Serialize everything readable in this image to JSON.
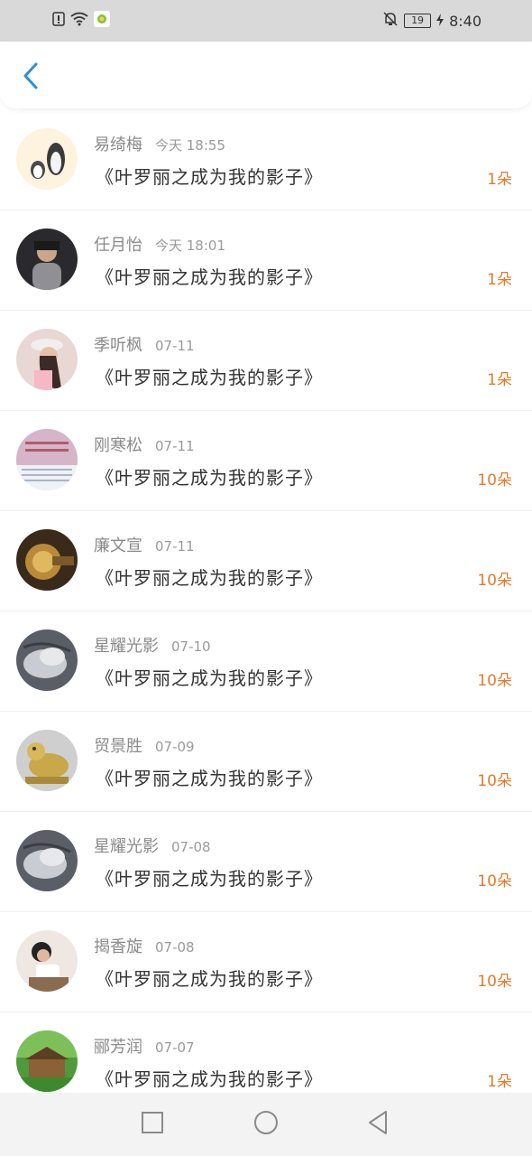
{
  "status_bar": {
    "time": "8:40",
    "battery": "19"
  },
  "header": {
    "back_icon": "chevron-left-icon",
    "accent": "#2b8fd6"
  },
  "colors": {
    "count": "#e47a2a",
    "name": "#8a8a8a"
  },
  "items": [
    {
      "name": "易绮梅",
      "time": "今天 18:55",
      "message": "《叶罗丽之成为我的影子》",
      "count": "1朵"
    },
    {
      "name": "任月怡",
      "time": "今天 18:01",
      "message": "《叶罗丽之成为我的影子》",
      "count": "1朵"
    },
    {
      "name": "季听枫",
      "time": "07-11",
      "message": "《叶罗丽之成为我的影子》",
      "count": "1朵"
    },
    {
      "name": "刚寒松",
      "time": "07-11",
      "message": "《叶罗丽之成为我的影子》",
      "count": "10朵"
    },
    {
      "name": "廉文宣",
      "time": "07-11",
      "message": "《叶罗丽之成为我的影子》",
      "count": "10朵"
    },
    {
      "name": "星耀光影",
      "time": "07-10",
      "message": "《叶罗丽之成为我的影子》",
      "count": "10朵"
    },
    {
      "name": "贸景胜",
      "time": "07-09",
      "message": "《叶罗丽之成为我的影子》",
      "count": "10朵"
    },
    {
      "name": "星耀光影",
      "time": "07-08",
      "message": "《叶罗丽之成为我的影子》",
      "count": "10朵"
    },
    {
      "name": "揭香旋",
      "time": "07-08",
      "message": "《叶罗丽之成为我的影子》",
      "count": "10朵"
    },
    {
      "name": "郦芳润",
      "time": "07-07",
      "message": "《叶罗丽之成为我的影子》",
      "count": "1朵"
    }
  ],
  "nav": {
    "recent_icon": "square-icon",
    "home_icon": "circle-icon",
    "back_icon": "triangle-back-icon"
  }
}
